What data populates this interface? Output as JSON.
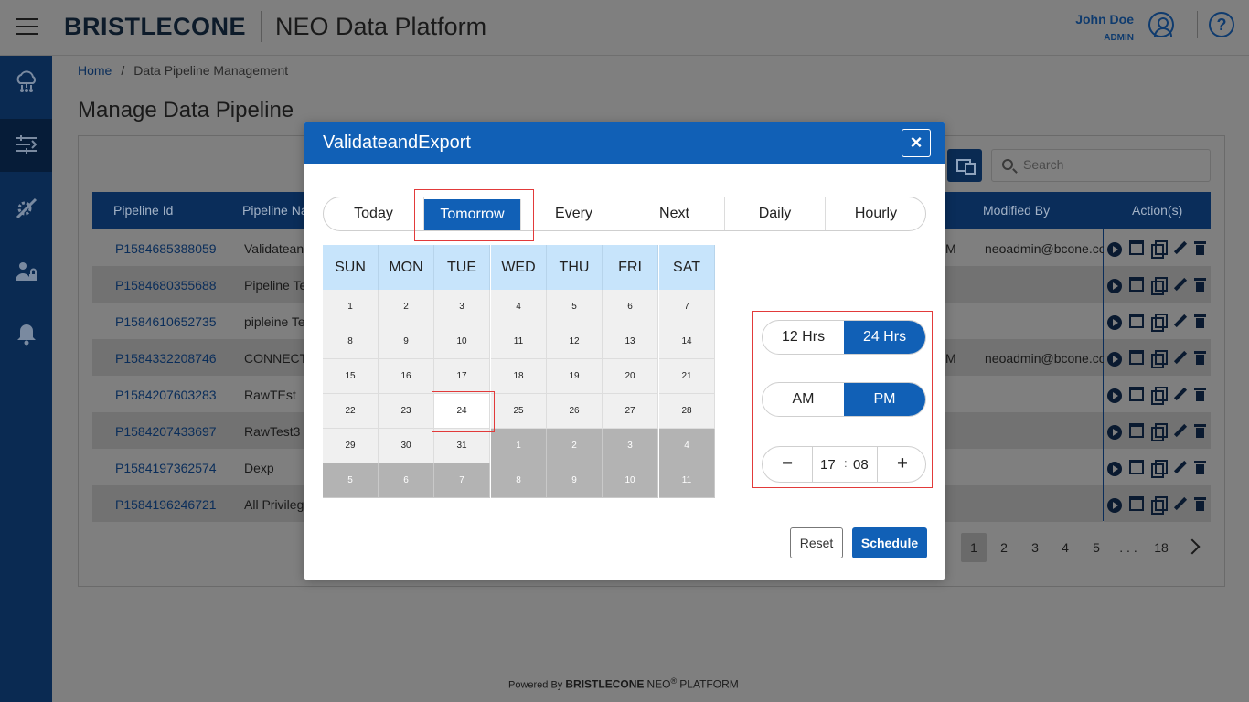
{
  "header": {
    "logo_text": "BRISTLECONE",
    "app_title": "NEO Data Platform",
    "user_name": "John Doe",
    "user_role": "ADMIN",
    "help_label": "?"
  },
  "sidebar": {
    "items": [
      {
        "icon": "cloud-network-icon"
      },
      {
        "icon": "pipeline-icon",
        "active": true
      },
      {
        "icon": "tools-icon"
      },
      {
        "icon": "user-lock-icon"
      },
      {
        "icon": "bell-icon"
      }
    ]
  },
  "breadcrumb": {
    "home": "Home",
    "separator": "/",
    "current": "Data Pipeline Management"
  },
  "page": {
    "title": "Manage Data Pipeline",
    "search_placeholder": "Search"
  },
  "table": {
    "columns": {
      "id": "Pipeline Id",
      "name": "Pipeline Na",
      "modified_by": "Modified By",
      "actions": "Action(s)"
    },
    "rows": [
      {
        "id": "P1584685388059",
        "name": "Validateand",
        "mtime": "M",
        "modified_by": "neoadmin@bcone.co"
      },
      {
        "id": "P1584680355688",
        "name": "Pipeline Te",
        "mtime": "",
        "modified_by": ""
      },
      {
        "id": "P1584610652735",
        "name": "pipleine Te",
        "mtime": "",
        "modified_by": ""
      },
      {
        "id": "P1584332208746",
        "name": "CONNECTI",
        "mtime": "M",
        "modified_by": "neoadmin@bcone.co"
      },
      {
        "id": "P1584207603283",
        "name": "RawTEst",
        "mtime": "",
        "modified_by": ""
      },
      {
        "id": "P1584207433697",
        "name": "RawTest3",
        "mtime": "",
        "modified_by": ""
      },
      {
        "id": "P1584197362574",
        "name": "Dexp",
        "mtime": "",
        "modified_by": ""
      },
      {
        "id": "P1584196246721",
        "name": "All Privilege",
        "mtime": "",
        "modified_by": ""
      }
    ]
  },
  "pagination": {
    "pages": [
      "1",
      "2",
      "3",
      "4",
      "5",
      ". . .",
      "18"
    ],
    "current": "1"
  },
  "footer": {
    "powered_by": "Powered By",
    "brand": "BRISTLECONE",
    "neo": "NEO",
    "reg": "®",
    "platform": "PLATFORM"
  },
  "modal": {
    "title": "ValidateandExport",
    "close_label": "×",
    "tabs": [
      "Today",
      "Tomorrow",
      "Every",
      "Next",
      "Daily",
      "Hourly"
    ],
    "active_tab": "Tomorrow",
    "calendar": {
      "weekdays": [
        "SUN",
        "MON",
        "TUE",
        "WED",
        "THU",
        "FRI",
        "SAT"
      ],
      "weeks": [
        [
          "1",
          "2",
          "3",
          "4",
          "5",
          "6",
          "7"
        ],
        [
          "8",
          "9",
          "10",
          "11",
          "12",
          "13",
          "14"
        ],
        [
          "15",
          "16",
          "17",
          "18",
          "19",
          "20",
          "21"
        ],
        [
          "22",
          "23",
          "24",
          "25",
          "26",
          "27",
          "28"
        ],
        [
          "29",
          "30",
          "31",
          "1",
          "2",
          "3",
          "4"
        ],
        [
          "5",
          "6",
          "7",
          "8",
          "9",
          "10",
          "11"
        ]
      ],
      "selected": "24"
    },
    "time_format": {
      "options": [
        "12 Hrs",
        "24 Hrs"
      ],
      "selected": "24 Hrs"
    },
    "meridiem": {
      "options": [
        "AM",
        "PM"
      ],
      "selected": "PM"
    },
    "time": {
      "hours": "17",
      "separator": ":",
      "minutes": "08",
      "minus": "−",
      "plus": "+"
    },
    "reset_label": "Reset",
    "schedule_label": "Schedule"
  },
  "colors": {
    "primary": "#1160b6",
    "navy": "#0a2d5a",
    "highlight": "#e23a3a",
    "calendar_header": "#c7e4fb"
  }
}
